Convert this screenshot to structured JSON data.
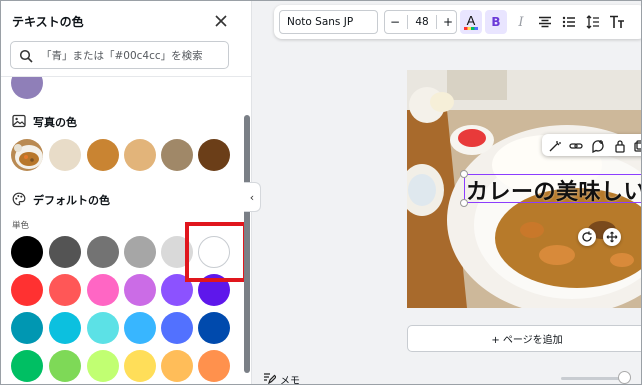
{
  "panel": {
    "title": "テキストの色",
    "search_placeholder": "「青」または「#00c4cc」を検索",
    "photo_section": "写真の色",
    "default_section": "デフォルトの色",
    "solid_label": "単色"
  },
  "colors": {
    "top_partial": "#8f7fb8",
    "photo": [
      "#e8dcc8",
      "#c98432",
      "#e2b47a",
      "#a08868",
      "#6b3e18"
    ],
    "solid_row1": [
      "#000000",
      "#545454",
      "#737373",
      "#a6a6a6",
      "#d9d9d9",
      "#ffffff"
    ],
    "solid_row2": [
      "#ff3131",
      "#ff5757",
      "#ff66c4",
      "#cb6ce6",
      "#8c52ff",
      "#5e17eb"
    ],
    "solid_row3": [
      "#0097b2",
      "#0cc0df",
      "#5ce1e6",
      "#38b6ff",
      "#5271ff",
      "#004aad"
    ],
    "solid_row4": [
      "#00bf63",
      "#7ed957",
      "#c1ff72",
      "#ffde59",
      "#ffbd59",
      "#ff914d"
    ],
    "highlight": "#e0161d",
    "accent": "#8b3dff"
  },
  "toolbar": {
    "font": "Noto Sans JP",
    "minus": "−",
    "size": "48",
    "plus": "+",
    "bold": "B",
    "italic": "I"
  },
  "canvas": {
    "text": "カレーの美味しい",
    "add_page": "+ ページを追加"
  },
  "footer": {
    "memo": "メモ"
  },
  "collapse_glyph": "‹"
}
